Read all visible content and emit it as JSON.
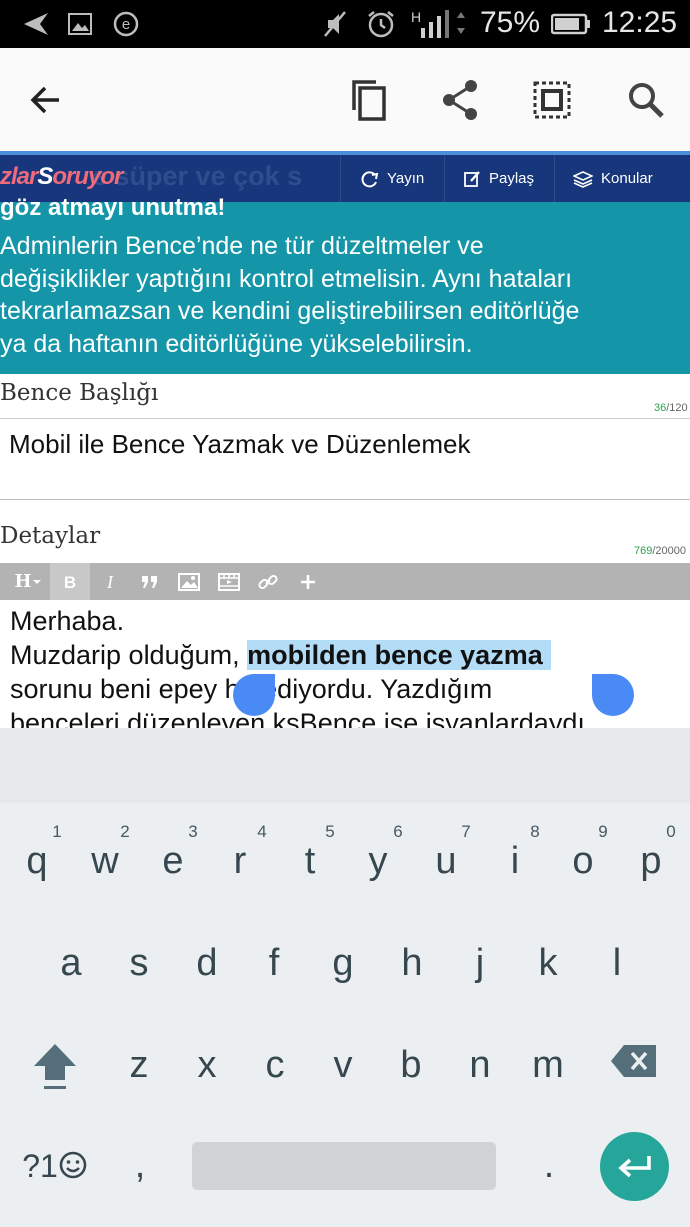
{
  "status_bar": {
    "battery_percent": "75%",
    "time": "12:25",
    "signal_label": "H",
    "icons": [
      "back-arrow-icon",
      "image-icon",
      "e-icon",
      "mute-icon",
      "alarm-icon",
      "signal-icon",
      "battery-icon"
    ]
  },
  "action_bar": {
    "icons": [
      "back-arrow-icon",
      "copy-icon",
      "share-icon",
      "select-all-icon",
      "search-icon"
    ]
  },
  "site": {
    "logo_part1": "zlar",
    "logo_part2": "S",
    "logo_part3": "oruyor",
    "ghost_text": "e süper ve çok s",
    "nav": [
      {
        "label": "Yayın",
        "icon": "refresh-icon"
      },
      {
        "label": "Paylaş",
        "icon": "edit-icon"
      },
      {
        "label": "Konular",
        "icon": "layers-icon"
      }
    ]
  },
  "banner": {
    "heading": "göz atmayı unutma!",
    "body": "Adminlerin Bence’nde ne tür düzeltmeler ve\ndeğişiklikler yaptığını kontrol etmelisin. Aynı hataları\ntekrarlamazsan ve kendini geliştirebilirsen editörlüğe\nya da haftanın editörlüğüne yükselebilirsin."
  },
  "form": {
    "title_label": "Bence Başlığı",
    "title_count": "36",
    "title_max": "/120",
    "title_value": "Mobil ile Bence Yazmak ve Düzenlemek",
    "details_label": "Detaylar",
    "details_count": "769",
    "details_max": "/20000",
    "toolbar_heading": "H",
    "editor_lines": {
      "l1": "Merhaba.",
      "l2_pre": "Muzdarip olduğum, ",
      "l2_sel": "mobilden bence yazma",
      "l3": "sorunu beni epey     hir ediyordu. Yazdığım",
      "l4": "benceleri düzenleyen ksBence ise isyanlardaydı"
    }
  },
  "keyboard": {
    "row1": [
      "q",
      "w",
      "e",
      "r",
      "t",
      "y",
      "u",
      "i",
      "o",
      "p"
    ],
    "row1_hints": [
      "1",
      "2",
      "3",
      "4",
      "5",
      "6",
      "7",
      "8",
      "9",
      "0"
    ],
    "row2": [
      "a",
      "s",
      "d",
      "f",
      "g",
      "h",
      "j",
      "k",
      "l"
    ],
    "row3": [
      "z",
      "x",
      "c",
      "v",
      "b",
      "n",
      "m"
    ],
    "symbols_key": "?1",
    "comma": ",",
    "period": "."
  }
}
